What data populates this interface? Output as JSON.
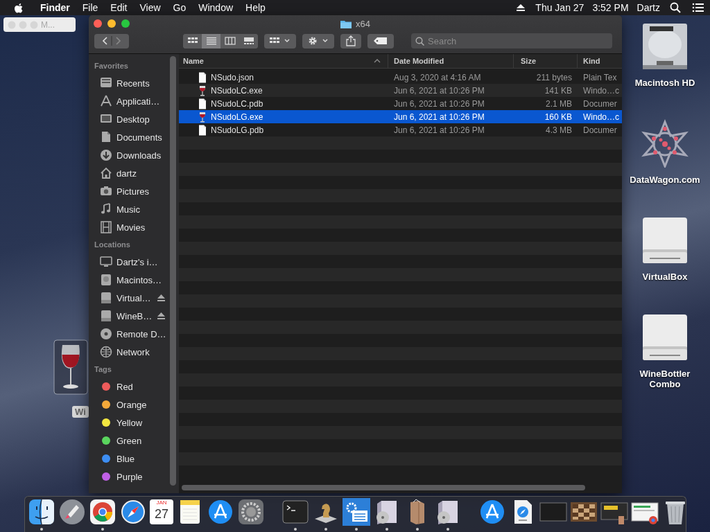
{
  "menu_bar": {
    "app_name": "Finder",
    "menus": [
      "File",
      "Edit",
      "View",
      "Go",
      "Window",
      "Help"
    ],
    "date": "Thu Jan 27",
    "time": "3:52 PM",
    "user": "Dartz"
  },
  "mini_window": {
    "title": "M..."
  },
  "desktop": {
    "partly_hidden_icon": {
      "label": "Wi"
    },
    "icons": [
      {
        "kind": "hard-disk",
        "label": "Macintosh HD"
      },
      {
        "kind": "star-logo",
        "label": "DataWagon.com"
      },
      {
        "kind": "external-drive",
        "label": "VirtualBox"
      },
      {
        "kind": "external-drive",
        "label": "WineBottler Combo"
      }
    ]
  },
  "window": {
    "title": "x64",
    "search": {
      "placeholder": "Search"
    },
    "view_modes": [
      {
        "selected": false
      },
      {
        "selected": true
      },
      {
        "selected": false
      },
      {
        "selected": false
      }
    ],
    "sidebar": [
      {
        "heading": "Favorites",
        "items": [
          {
            "kind": "tray",
            "label": "Recents"
          },
          {
            "kind": "apps",
            "label": "Applicati…"
          },
          {
            "kind": "display",
            "label": "Desktop"
          },
          {
            "kind": "document",
            "label": "Documents"
          },
          {
            "kind": "download",
            "label": "Downloads"
          },
          {
            "kind": "house",
            "label": "dartz"
          },
          {
            "kind": "camera",
            "label": "Pictures"
          },
          {
            "kind": "note",
            "label": "Music"
          },
          {
            "kind": "film",
            "label": "Movies"
          }
        ]
      },
      {
        "heading": "Locations",
        "items": [
          {
            "kind": "monitor",
            "label": "Dartz's i…",
            "eject": false
          },
          {
            "kind": "disk",
            "label": "Macintos…",
            "eject": false
          },
          {
            "kind": "drive",
            "label": "Virtual…",
            "eject": true
          },
          {
            "kind": "drive",
            "label": "WineB…",
            "eject": true
          },
          {
            "kind": "disc",
            "label": "Remote D…",
            "eject": false
          },
          {
            "kind": "globe",
            "label": "Network",
            "eject": false
          }
        ]
      },
      {
        "heading": "Tags",
        "items": [
          {
            "label": "Red",
            "color": "#ee5b5b"
          },
          {
            "label": "Orange",
            "color": "#f4a93a"
          },
          {
            "label": "Yellow",
            "color": "#f2e640"
          },
          {
            "label": "Green",
            "color": "#5ad55e"
          },
          {
            "label": "Blue",
            "color": "#3d8ef3"
          },
          {
            "label": "Purple",
            "color": "#c160e6"
          }
        ]
      }
    ],
    "columns": [
      "Name",
      "Date Modified",
      "Size",
      "Kind"
    ],
    "rows": [
      {
        "kind": "document",
        "cells": [
          "NSudo.json",
          "Aug 3, 2020 at 4:16 AM",
          "211 bytes",
          "Plain Tex"
        ],
        "selected": false
      },
      {
        "kind": "wine",
        "cells": [
          "NSudoLC.exe",
          "Jun 6, 2021 at 10:26 PM",
          "141 KB",
          "Windo…c"
        ],
        "selected": false
      },
      {
        "kind": "document",
        "cells": [
          "NSudoLC.pdb",
          "Jun 6, 2021 at 10:26 PM",
          "2.1 MB",
          "Documer"
        ],
        "selected": false
      },
      {
        "kind": "wine",
        "cells": [
          "NSudoLG.exe",
          "Jun 6, 2021 at 10:26 PM",
          "160 KB",
          "Windo…c"
        ],
        "selected": true
      },
      {
        "kind": "document",
        "cells": [
          "NSudoLG.pdb",
          "Jun 6, 2021 at 10:26 PM",
          "4.3 MB",
          "Documer"
        ],
        "selected": false
      }
    ]
  },
  "dock": {
    "calendar": {
      "month": "JAN",
      "day": "27"
    },
    "items": [
      {
        "kind": "finder",
        "running": true
      },
      {
        "kind": "launchpad",
        "running": false
      },
      {
        "kind": "chrome",
        "running": true
      },
      {
        "kind": "safari",
        "running": false
      },
      {
        "kind": "calendar",
        "running": false
      },
      {
        "kind": "notes",
        "running": false
      },
      {
        "kind": "app-store",
        "running": false
      },
      {
        "kind": "preferences",
        "running": false
      },
      {
        "kind": "separator"
      },
      {
        "kind": "terminal",
        "running": true
      },
      {
        "kind": "chess",
        "running": true
      },
      {
        "kind": "settings-list",
        "running": true
      },
      {
        "kind": "installer",
        "running": true
      },
      {
        "kind": "box",
        "running": true
      },
      {
        "kind": "installer",
        "running": true
      },
      {
        "kind": "separator"
      },
      {
        "kind": "app-store",
        "running": false
      },
      {
        "kind": "url-file",
        "running": false
      },
      {
        "kind": "dark-window",
        "running": false
      },
      {
        "kind": "chess-board",
        "running": false
      },
      {
        "kind": "card-window",
        "running": false
      },
      {
        "kind": "web-window",
        "running": false
      },
      {
        "kind": "trash",
        "running": false
      }
    ]
  }
}
